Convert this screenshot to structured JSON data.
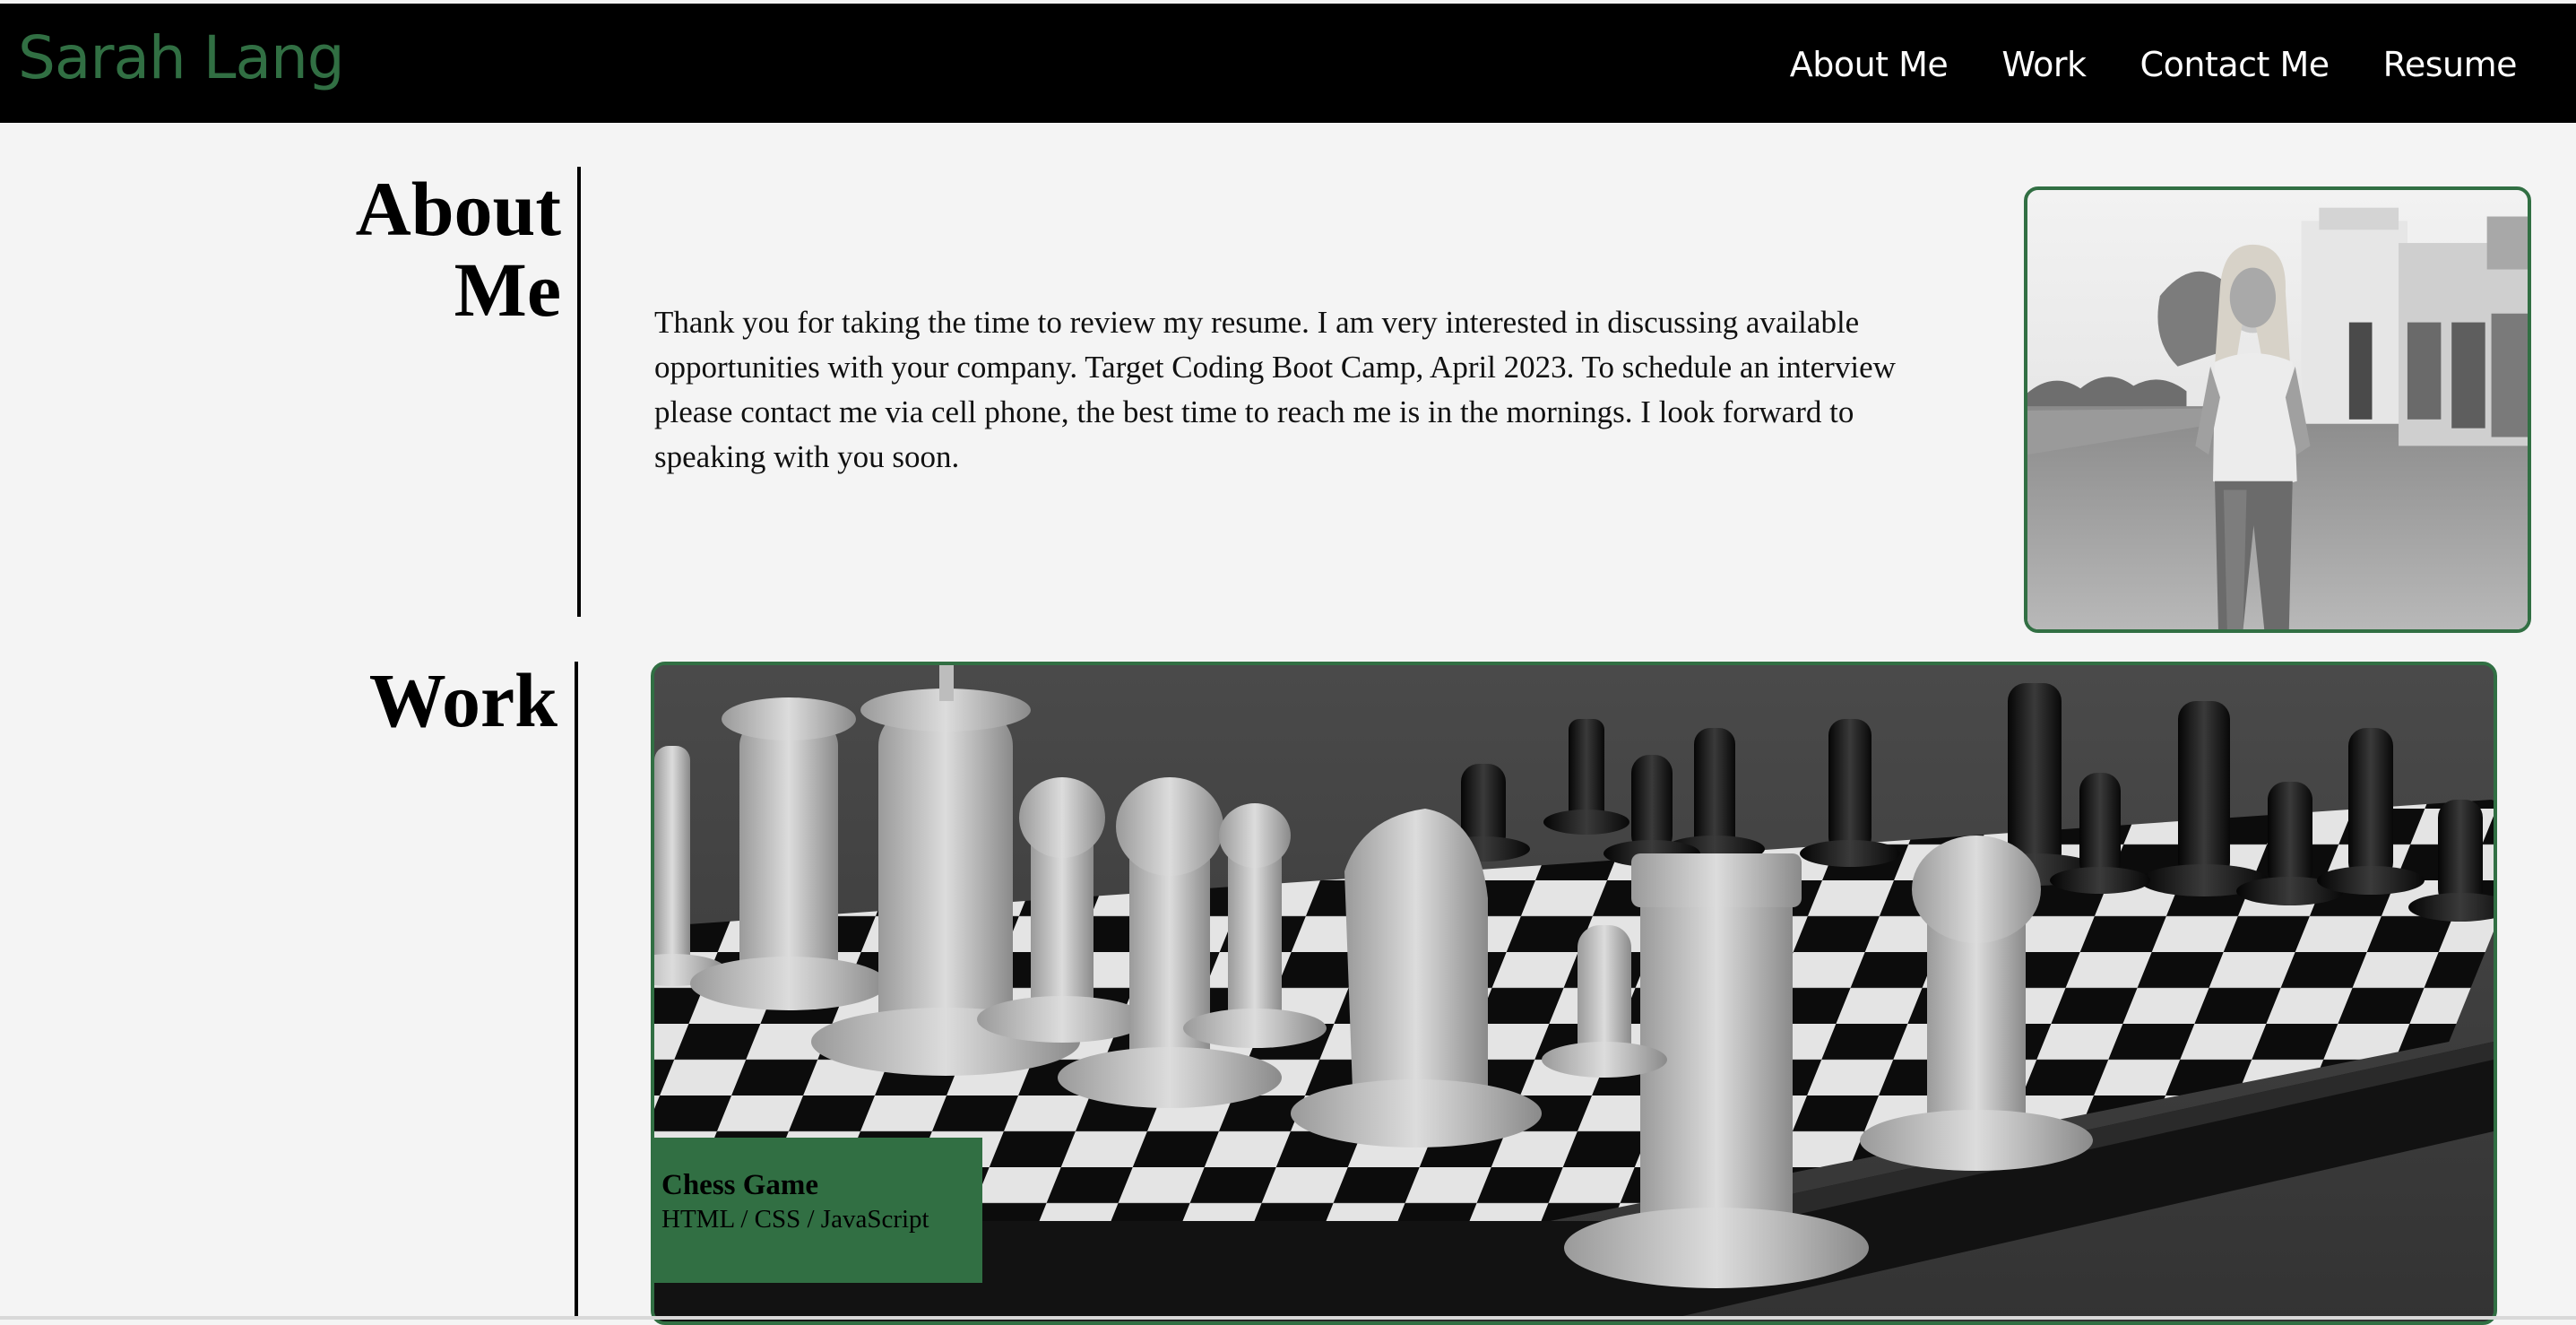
{
  "header": {
    "brand": "Sarah Lang",
    "nav": [
      "About Me",
      "Work",
      "Contact Me",
      "Resume"
    ]
  },
  "about": {
    "title_line1": "About",
    "title_line2": "Me",
    "text": "Thank you for taking the time to review my resume. I am very interested in discussing available opportunities with your company. Target Coding Boot Camp, April 2023. To schedule an interview please contact me via cell phone, the best time to reach me is in the mornings. I look forward to speaking with you soon."
  },
  "work": {
    "title": "Work",
    "projects": [
      {
        "name": "Chess Game",
        "tech": "HTML / CSS / JavaScript"
      }
    ]
  },
  "colors": {
    "accent": "#316f43",
    "header_bg": "#000000",
    "page_bg": "#f4f4f4"
  }
}
